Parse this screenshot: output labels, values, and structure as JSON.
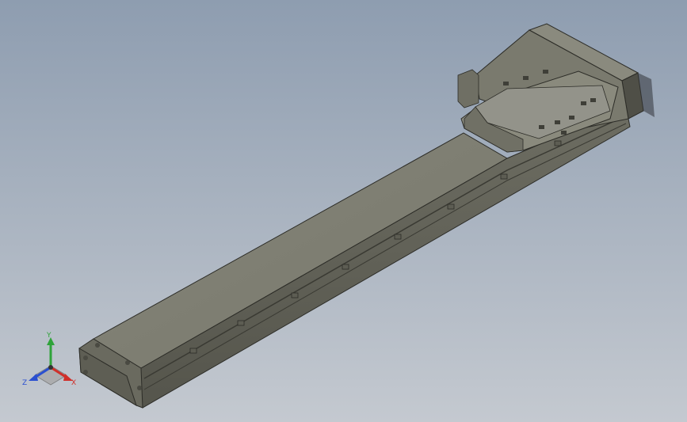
{
  "viewport": {
    "background_top": "#8e9db0",
    "background_bottom": "#c4c9d0"
  },
  "model": {
    "body_top_color": "#7f7f72",
    "body_side_color": "#66665b",
    "rail_color": "#54544b",
    "outline_color": "#2c2c27",
    "carriage_color": "#8a8a7d"
  },
  "triad": {
    "x_label": "X",
    "y_label": "Y",
    "z_label": "Z",
    "x_color": "#d0302a",
    "y_color": "#2fa33a",
    "z_color": "#2a4fd0",
    "icon": "coordinate-triad-icon"
  }
}
